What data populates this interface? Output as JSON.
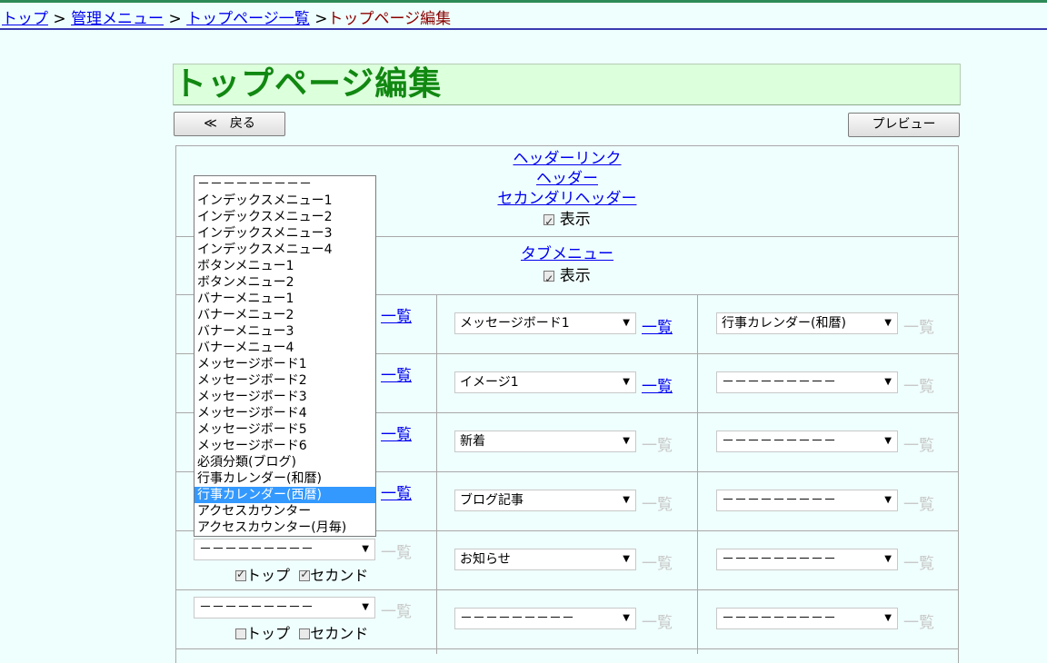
{
  "breadcrumb": {
    "items": [
      "トップ",
      "管理メニュー",
      "トップページ一覧"
    ],
    "separator": ">",
    "current": "トップページ編集"
  },
  "page_title": "トップページ編集",
  "buttons": {
    "back": "≪　戻る",
    "preview": "プレビュー"
  },
  "header_section": {
    "links": [
      "ヘッダーリンク",
      "ヘッダー",
      "セカンダリヘッダー"
    ],
    "display_label": "表示",
    "display_checked": true
  },
  "tab_section": {
    "link": "タブメニュー",
    "display_label": "表示",
    "display_checked": true
  },
  "list_link": "一覧",
  "dropdown_options": [
    "－－－－－－－－－",
    "インデックスメニュー1",
    "インデックスメニュー2",
    "インデックスメニュー3",
    "インデックスメニュー4",
    "ボタンメニュー1",
    "ボタンメニュー2",
    "バナーメニュー1",
    "バナーメニュー2",
    "バナーメニュー3",
    "バナーメニュー4",
    "メッセージボード1",
    "メッセージボード2",
    "メッセージボード3",
    "メッセージボード4",
    "メッセージボード5",
    "メッセージボード6",
    "必須分類(ブログ)",
    "行事カレンダー(和暦)",
    "行事カレンダー(西暦)",
    "アクセスカウンター",
    "アクセスカウンター(月毎)"
  ],
  "dropdown_highlighted": "行事カレンダー(西暦)",
  "rows": [
    {
      "left": "",
      "mid": "メッセージボード1",
      "right": "行事カレンダー(和暦)"
    },
    {
      "left": "",
      "mid": "イメージ1",
      "right": "－－－－－－－－－"
    },
    {
      "left": "",
      "mid": "新着",
      "right": "－－－－－－－－－"
    },
    {
      "left": "",
      "mid": "ブログ記事",
      "right": "－－－－－－－－－"
    },
    {
      "left": "－－－－－－－－－",
      "mid": "お知らせ",
      "right": "－－－－－－－－－",
      "top_checked": true,
      "second_checked": true
    },
    {
      "left": "－－－－－－－－－",
      "mid": "－－－－－－－－－",
      "right": "－－－－－－－－－",
      "top_checked": false,
      "second_checked": false
    }
  ],
  "checkbox_labels": {
    "top": "トップ",
    "second": "セカンド"
  }
}
